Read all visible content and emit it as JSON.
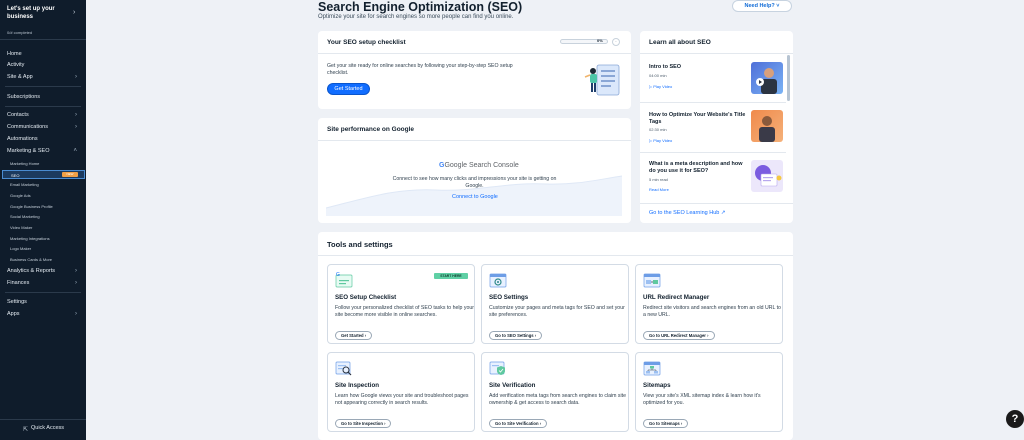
{
  "sidebar": {
    "site_title": "Let's set up your business",
    "progress_text": "0/# completed",
    "items": {
      "home": "Home",
      "activity": "Activity",
      "site_app": "Site & App",
      "subscriptions": "Subscriptions",
      "contacts": "Contacts",
      "communications": "Communications",
      "automations": "Automations",
      "marketing_seo": "Marketing & SEO",
      "analytics": "Analytics & Reports",
      "finances": "Finances",
      "settings": "Settings",
      "apps": "Apps"
    },
    "sub_items": [
      "Marketing Home",
      "SEO",
      "Email Marketing",
      "Google Ads",
      "Google Business Profile",
      "Social Marketing",
      "Video Maker",
      "Marketing Integrations",
      "Logo Maker",
      "Business Cards & More"
    ],
    "seo_badge": "NEW",
    "quick_access": "Quick Access"
  },
  "header": {
    "title": "Search Engine Optimization (SEO)",
    "subtitle": "Optimize your site for search engines so more people can find you online.",
    "help_label": "Need Help?"
  },
  "checklist": {
    "title": "Your SEO setup checklist",
    "percent": "0%",
    "progress_fraction": 0,
    "body": "Get your site ready for online searches by following your step-by-step SEO setup checklist.",
    "button": "Get Started"
  },
  "performance": {
    "title": "Site performance on Google",
    "logo_text": "Google Search Console",
    "body": "Connect to see how many clicks and impressions your site is getting on Google.",
    "link": "Connect to Google"
  },
  "learn": {
    "title": "Learn all about SEO",
    "items": [
      {
        "title": "Intro to SEO",
        "meta": "04:00 min",
        "link": "Play Video"
      },
      {
        "title": "How to Optimize Your Website's Title Tags",
        "meta": "02:30 min",
        "link": "Play Video"
      },
      {
        "title": "What is a meta description and how do you use it for SEO?",
        "meta": "5 min read",
        "link": "Read More"
      }
    ],
    "footer_link": "Go to the SEO Learning Hub"
  },
  "tools": {
    "title": "Tools and settings",
    "start_badge": "START HERE",
    "cards": [
      {
        "title": "SEO Setup Checklist",
        "desc": "Follow your personalized checklist of SEO tasks to help your site become more visible in online searches.",
        "button": "Get Started"
      },
      {
        "title": "SEO Settings",
        "desc": "Customize your pages and meta tags for SEO and set your site preferences.",
        "button": "Go to SEO Settings"
      },
      {
        "title": "URL Redirect Manager",
        "desc": "Redirect site visitors and search engines from an old URL to a new URL.",
        "button": "Go to URL Redirect Manager"
      },
      {
        "title": "Site Inspection",
        "desc": "Learn how Google views your site and troubleshoot pages not appearing correctly in search results.",
        "button": "Go to Site Inspection"
      },
      {
        "title": "Site Verification",
        "desc": "Add verification meta tags from search engines to claim site ownership & get access to search data.",
        "button": "Go to Site Verification"
      },
      {
        "title": "Sitemaps",
        "desc": "View your site's XML sitemap index & learn how it's optimized for you.",
        "button": "Go to Sitemaps"
      }
    ]
  },
  "fab_label": "?",
  "colors": {
    "accent": "#116dff",
    "sidebar_bg": "#0f1c2b",
    "badge": "#f1a046",
    "start_badge": "#5fd0a5"
  }
}
